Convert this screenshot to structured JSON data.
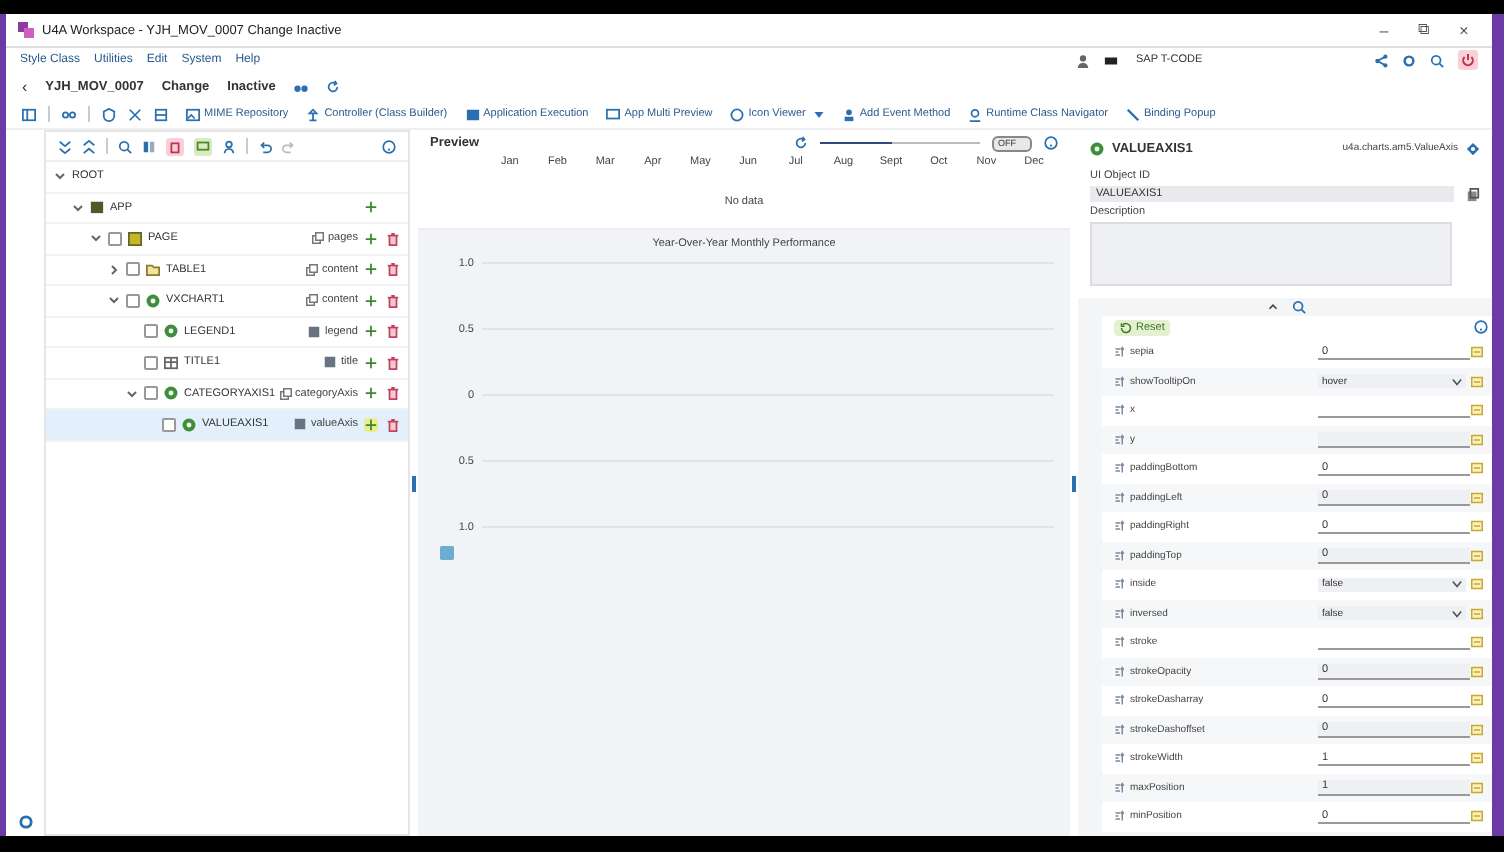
{
  "window": {
    "title": "U4A Workspace - YJH_MOV_0007 Change Inactive",
    "controls": [
      "–",
      "⧉",
      "×"
    ]
  },
  "menu": [
    "Style Class",
    "Utilities",
    "Edit",
    "System",
    "Help"
  ],
  "tcode": {
    "placeholder": "SAP T-CODE"
  },
  "header": {
    "back": "‹",
    "app_id": "YJH_MOV_0007",
    "mode": "Change",
    "status": "Inactive"
  },
  "toolbar": [
    {
      "kind": "mime",
      "label": "MIME Repository"
    },
    {
      "kind": "controller",
      "label": "Controller (Class Builder)"
    },
    {
      "kind": "execute",
      "label": "Application Execution"
    },
    {
      "kind": "preview",
      "label": "App Multi Preview"
    },
    {
      "kind": "icons",
      "label": "Icon Viewer",
      "dropdown": true
    },
    {
      "kind": "event",
      "label": "Add Event Method"
    },
    {
      "kind": "navigator",
      "label": "Runtime Class Navigator"
    },
    {
      "kind": "binding",
      "label": "Binding Popup"
    }
  ],
  "tree": [
    {
      "name": "ROOT",
      "expanded": true,
      "selected": false,
      "children": [
        {
          "name": "APP",
          "kind": "app",
          "expanded": true,
          "selected": false,
          "children": [
            {
              "name": "PAGE",
              "kind": "page",
              "expanded": true,
              "selected": false,
              "checked": false,
              "aggregation": "pages",
              "agg_multiple": true,
              "children": [
                {
                  "name": "TABLE1",
                  "kind": "folder",
                  "expanded": false,
                  "selected": false,
                  "checked": false,
                  "aggregation": "content",
                  "agg_multiple": true
                },
                {
                  "name": "VXCHART1",
                  "kind": "chart",
                  "expanded": true,
                  "selected": false,
                  "checked": false,
                  "aggregation": "content",
                  "agg_multiple": true,
                  "children": [
                    {
                      "name": "LEGEND1",
                      "kind": "chart",
                      "selected": false,
                      "checked": false,
                      "aggregation": "legend",
                      "agg_multiple": false
                    },
                    {
                      "name": "TITLE1",
                      "kind": "title",
                      "selected": false,
                      "checked": false,
                      "aggregation": "title",
                      "agg_multiple": false
                    },
                    {
                      "name": "CATEGORYAXIS1",
                      "kind": "chart",
                      "expanded": true,
                      "selected": false,
                      "checked": false,
                      "aggregation": "categoryAxis",
                      "agg_multiple": true,
                      "children": [
                        {
                          "name": "VALUEAXIS1",
                          "kind": "chart",
                          "selected": true,
                          "checked": false,
                          "aggregation": "valueAxis",
                          "agg_multiple": false
                        }
                      ]
                    }
                  ]
                }
              ]
            }
          ]
        }
      ]
    }
  ],
  "preview": {
    "title": "Preview",
    "zoom": {
      "level": 0.45
    },
    "toggle": {
      "label": "OFF",
      "on": false
    },
    "months": [
      "Jan",
      "Feb",
      "Mar",
      "Apr",
      "May",
      "Jun",
      "Jul",
      "Aug",
      "Sept",
      "Oct",
      "Nov",
      "Dec"
    ],
    "empty_text": "No data",
    "chart": {
      "title": "Year-Over-Year Monthly Performance",
      "y_ticks": [
        "1.0",
        "0.5",
        "0",
        "0.5",
        "1.0"
      ]
    }
  },
  "object": {
    "name": "VALUEAXIS1",
    "class": "u4a.charts.am5.ValueAxis",
    "id_label": "UI Object ID",
    "id_value": "VALUEAXIS1",
    "description_label": "Description"
  },
  "properties": {
    "reset": "Reset",
    "rows": [
      {
        "name": "sepia",
        "kind": "input",
        "value": "0"
      },
      {
        "name": "showTooltipOn",
        "kind": "select",
        "value": "hover"
      },
      {
        "name": "x",
        "kind": "input"
      },
      {
        "name": "y",
        "kind": "input"
      },
      {
        "name": "paddingBottom",
        "kind": "input",
        "value": "0"
      },
      {
        "name": "paddingLeft",
        "kind": "input",
        "value": "0"
      },
      {
        "name": "paddingRight",
        "kind": "input",
        "value": "0"
      },
      {
        "name": "paddingTop",
        "kind": "input",
        "value": "0"
      },
      {
        "name": "inside",
        "kind": "select",
        "value": "false"
      },
      {
        "name": "inversed",
        "kind": "select",
        "value": "false"
      },
      {
        "name": "stroke",
        "kind": "input"
      },
      {
        "name": "strokeOpacity",
        "kind": "input",
        "value": "0"
      },
      {
        "name": "strokeDasharray",
        "kind": "input",
        "value": "0"
      },
      {
        "name": "strokeDashoffset",
        "kind": "input",
        "value": "0"
      },
      {
        "name": "strokeWidth",
        "kind": "input",
        "value": "1"
      },
      {
        "name": "maxPosition",
        "kind": "input",
        "value": "1"
      },
      {
        "name": "minPosition",
        "kind": "input",
        "value": "0"
      }
    ]
  }
}
